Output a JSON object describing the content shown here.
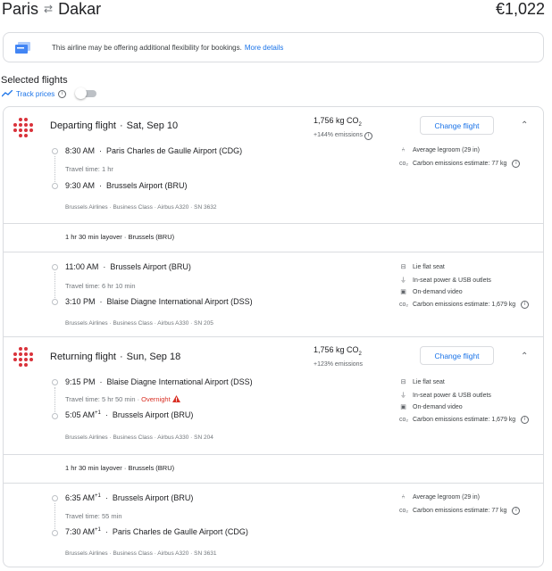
{
  "header": {
    "origin": "Paris",
    "swap_icon": "⇄",
    "destination": "Dakar",
    "price": "€1,022"
  },
  "banner": {
    "text": "This airline may be offering additional flexibility for bookings.",
    "link": "More details"
  },
  "selected": {
    "title": "Selected flights",
    "track_label": "Track prices",
    "track_on": false
  },
  "change_label": "Change flight",
  "departing": {
    "heading": "Departing flight",
    "date": "Sat, Sep 10",
    "co2": "1,756 kg CO",
    "co2_sub": "2",
    "emissions": "+144% emissions",
    "legs": [
      {
        "dep_time": "8:30 AM",
        "dep_airport": "Paris Charles de Gaulle Airport (CDG)",
        "travel": "Travel time: 1 hr",
        "arr_time": "9:30 AM",
        "arr_sup": "",
        "arr_airport": "Brussels Airport (BRU)",
        "meta": "Brussels Airlines · Business Class · Airbus A320 · SN 3632",
        "amenities": [
          "Average legroom (29 in)",
          "Carbon emissions estimate: 77 kg"
        ]
      },
      {
        "dep_time": "11:00 AM",
        "dep_airport": "Brussels Airport (BRU)",
        "travel": "Travel time: 6 hr 10 min",
        "arr_time": "3:10 PM",
        "arr_sup": "",
        "arr_airport": "Blaise Diagne International Airport (DSS)",
        "meta": "Brussels Airlines · Business Class · Airbus A330 · SN 205",
        "amenities": [
          "Lie flat seat",
          "In-seat power & USB outlets",
          "On-demand video",
          "Carbon emissions estimate: 1,679 kg"
        ]
      }
    ],
    "layover": "1 hr 30 min layover · Brussels (BRU)"
  },
  "returning": {
    "heading": "Returning flight",
    "date": "Sun, Sep 18",
    "co2": "1,756 kg CO",
    "co2_sub": "2",
    "emissions": "+123% emissions",
    "legs": [
      {
        "dep_time": "9:15 PM",
        "dep_airport": "Blaise Diagne International Airport (DSS)",
        "travel": "Travel time: 5 hr 50 min",
        "overnight": "Overnight",
        "arr_time": "5:05 AM",
        "arr_sup": "+1",
        "arr_airport": "Brussels Airport (BRU)",
        "meta": "Brussels Airlines · Business Class · Airbus A330 · SN 204",
        "amenities": [
          "Lie flat seat",
          "In-seat power & USB outlets",
          "On-demand video",
          "Carbon emissions estimate: 1,679 kg"
        ]
      },
      {
        "dep_time": "6:35 AM",
        "dep_sup": "+1",
        "dep_airport": "Brussels Airport (BRU)",
        "travel": "Travel time: 55 min",
        "arr_time": "7:30 AM",
        "arr_sup": "+1",
        "arr_airport": "Paris Charles de Gaulle Airport (CDG)",
        "meta": "Brussels Airlines · Business Class · Airbus A320 · SN 3631",
        "amenities": [
          "Average legroom (29 in)",
          "Carbon emissions estimate: 77 kg"
        ]
      }
    ],
    "layover": "1 hr 30 min layover · Brussels (BRU)"
  }
}
